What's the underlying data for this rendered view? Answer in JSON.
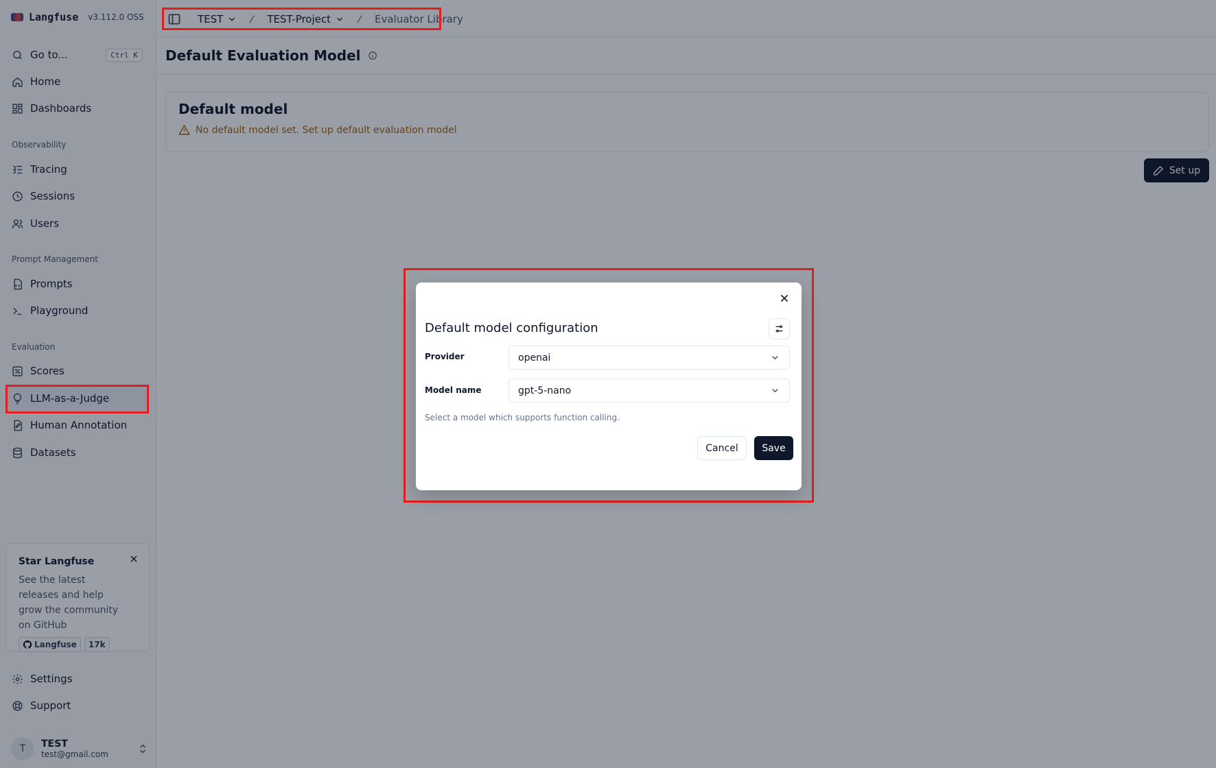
{
  "brand": {
    "name": "Langfuse",
    "version": "v3.112.0 OSS"
  },
  "sidebar": {
    "goto": {
      "label": "Go to...",
      "shortcut": "Ctrl K"
    },
    "top_items": [
      {
        "label": "Home",
        "icon": "home-icon"
      },
      {
        "label": "Dashboards",
        "icon": "dashboards-icon"
      }
    ],
    "sections": [
      {
        "label": "Observability",
        "items": [
          {
            "label": "Tracing",
            "icon": "list-tree-icon"
          },
          {
            "label": "Sessions",
            "icon": "clock-icon"
          },
          {
            "label": "Users",
            "icon": "users-icon"
          }
        ]
      },
      {
        "label": "Prompt Management",
        "items": [
          {
            "label": "Prompts",
            "icon": "file-code-icon"
          },
          {
            "label": "Playground",
            "icon": "terminal-icon"
          }
        ]
      },
      {
        "label": "Evaluation",
        "items": [
          {
            "label": "Scores",
            "icon": "percent-box-icon"
          },
          {
            "label": "LLM-as-a-Judge",
            "icon": "lightbulb-icon",
            "active": true
          },
          {
            "label": "Human Annotation",
            "icon": "annotation-icon"
          },
          {
            "label": "Datasets",
            "icon": "database-icon"
          }
        ]
      }
    ],
    "star_card": {
      "title": "Star Langfuse",
      "text": "See the latest releases and help grow the community on GitHub",
      "github_label": "Langfuse",
      "github_count": "17k"
    },
    "bottom_items": [
      {
        "label": "Settings",
        "icon": "gear-icon"
      },
      {
        "label": "Support",
        "icon": "lifebuoy-icon"
      }
    ],
    "user": {
      "initial": "T",
      "name": "TEST",
      "email": "test@gmail.com"
    }
  },
  "topbar": {
    "breadcrumb": {
      "org": "TEST",
      "project": "TEST-Project",
      "page": "Evaluator Library"
    }
  },
  "page": {
    "title": "Default Evaluation Model",
    "card_title": "Default model",
    "warning": "No default model set. Set up default evaluation model",
    "setup_button": "Set up"
  },
  "modal": {
    "title": "Default model configuration",
    "provider_label": "Provider",
    "provider_value": "openai",
    "model_label": "Model name",
    "model_value": "gpt-5-nano",
    "hint": "Select a model which supports function calling.",
    "cancel": "Cancel",
    "save": "Save"
  },
  "colors": {
    "accent": "#0f172a",
    "warning": "#a16207",
    "highlight": "#e11d1d"
  }
}
